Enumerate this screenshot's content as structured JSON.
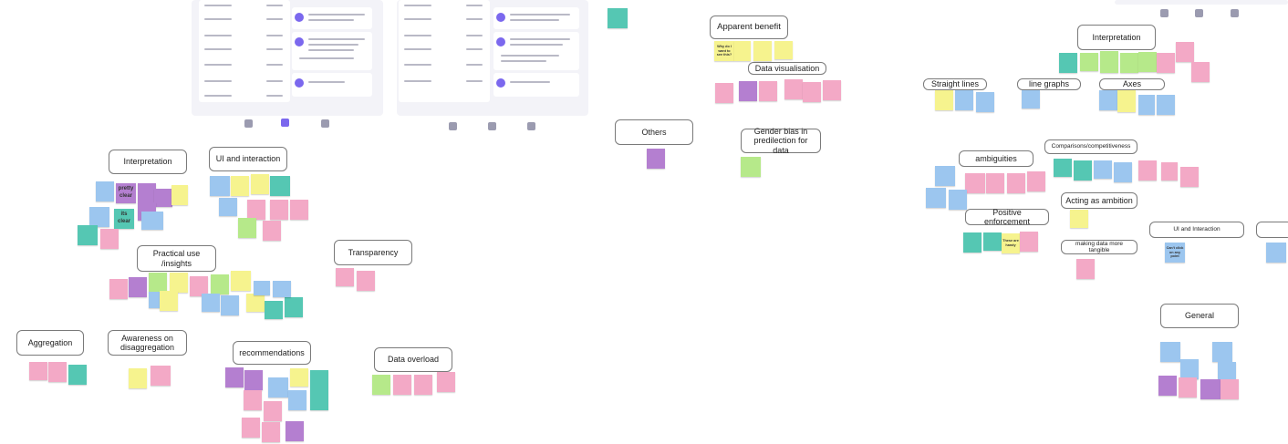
{
  "colors": {
    "pink": "#f3a9c6",
    "purple": "#b47fd0",
    "blue": "#9cc6ef",
    "yellow": "#f6f38e",
    "green": "#b6e98a",
    "teal": "#55c7b3",
    "accent": "#7b68ee"
  },
  "labels": {
    "apparent_benefit": "Apparent benefit",
    "data_visualisation": "Data visualisation",
    "others": "Others",
    "gender_bias": "Gender bias in predilection for data",
    "interpretation_right": "Interpretation",
    "straight_lines": "Straight lines",
    "line_graphs": "line graphs",
    "axes": "Axes",
    "ambiguities": "ambiguities",
    "comparisons": "Comparisons/competitiveness",
    "acting_as_ambition": "Acting as ambition",
    "positive_enforcement": "Positive enforcement",
    "making_data_tangible": "making data more tangible",
    "ui_interaction_right": "UI and Interaction",
    "general": "General",
    "interpretation_left": "Interpretation",
    "ui_interaction_left": "UI and interaction",
    "practical_use": "Practical use /insights",
    "transparency": "Transparency",
    "aggregation": "Aggregation",
    "awareness_disaggregation": "Awareness on disaggregation",
    "recommendations": "recommendations",
    "data_overload": "Data overload"
  },
  "stickies": {
    "pretty_clear": "pretty clear",
    "its_clear": "its clear",
    "why_is_it_good": "Why do I want to see this?",
    "these_are_handy": "These are handy",
    "cant_click": "Can't click on any point"
  }
}
